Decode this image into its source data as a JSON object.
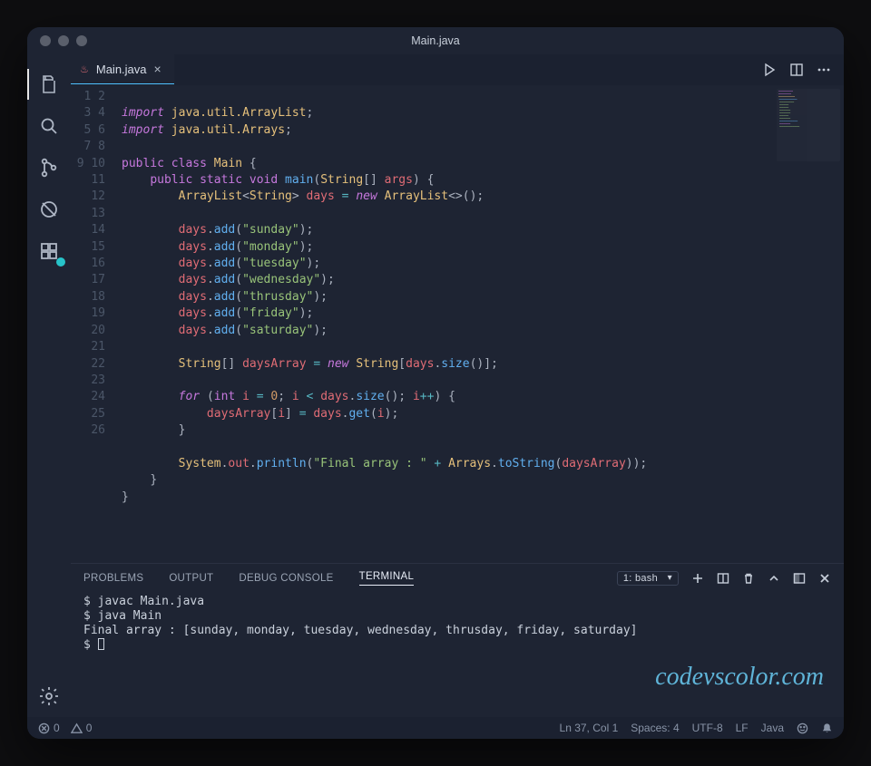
{
  "window": {
    "title": "Main.java"
  },
  "tab": {
    "filename": "Main.java"
  },
  "line_numbers": [
    "1",
    "2",
    "3",
    "4",
    "5",
    "6",
    "7",
    "8",
    "9",
    "10",
    "11",
    "12",
    "13",
    "14",
    "15",
    "16",
    "17",
    "18",
    "19",
    "20",
    "21",
    "22",
    "23",
    "24",
    "25",
    "26"
  ],
  "code": {
    "import1_pkg": "java.util.ArrayList",
    "import2_pkg": "java.util.Arrays",
    "class_name": "Main",
    "method_name": "main",
    "param_type": "String",
    "param_name": "args",
    "list_type": "ArrayList",
    "generic": "String",
    "var_days": "days",
    "add": "add",
    "d0": "\"sunday\"",
    "d1": "\"monday\"",
    "d2": "\"tuesday\"",
    "d3": "\"wednesday\"",
    "d4": "\"thrusday\"",
    "d5": "\"friday\"",
    "d6": "\"saturday\"",
    "arr_type": "String",
    "var_arr": "daysArray",
    "size": "size",
    "for_kw": "for",
    "int_kw": "int",
    "i": "i",
    "zero": "0",
    "get": "get",
    "println": "println",
    "system": "System",
    "out": "out",
    "final_str": "\"Final array : \"",
    "arrays": "Arrays",
    "toString": "toString",
    "kw_import": "import",
    "kw_public": "public",
    "kw_class": "class",
    "kw_static": "static",
    "kw_void": "void",
    "kw_new": "new"
  },
  "panel": {
    "tabs": {
      "problems": "PROBLEMS",
      "output": "OUTPUT",
      "debug": "DEBUG CONSOLE",
      "terminal": "TERMINAL"
    },
    "term_label": "1: bash",
    "lines": {
      "l1": "$ javac Main.java",
      "l2": "$ java Main",
      "l3": "Final array : [sunday, monday, tuesday, wednesday, thrusday, friday, saturday]",
      "l4_prefix": "$ "
    }
  },
  "status": {
    "errors": "0",
    "warnings": "0",
    "cursor": "Ln 37, Col 1",
    "spaces": "Spaces: 4",
    "encoding": "UTF-8",
    "eol": "LF",
    "lang": "Java"
  },
  "watermark": "codevscolor.com"
}
